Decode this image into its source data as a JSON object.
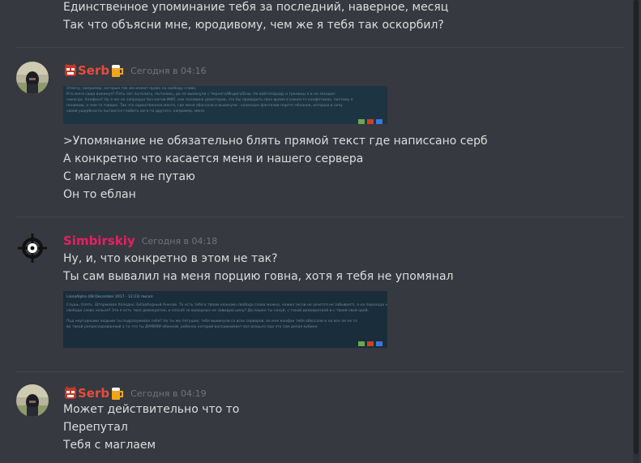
{
  "colors": {
    "background": "#36393f",
    "text": "#dcddde",
    "timestamp": "#72767d",
    "serb_name": "#e74c3c",
    "simbirskiy_name": "#e91e63"
  },
  "top_lines": [
    "Единственное упоминание тебя за последний, наверное, месяц",
    "Так что объясни мне, юродивому, чем же я тебя так оскорбил?"
  ],
  "messages": [
    {
      "author": "Serb",
      "timestamp": "Сегодня в 04:16",
      "icons": [
        "oni-mask-icon",
        "beer-mug-icon"
      ],
      "embed_lines": [
        "Отвечу, например, которые так же имеют право на свободу слова.",
        "Кто меня сюда выкинул? Пять лет пытались, пытались, да не выкинули с Черного/Индиго/Блю. Не вайтопараду и границы я и не заходил",
        "никогда. Апофеоз? Ну я же не запрещал без матов ИФП, как половина дематеров, что бы проводить свое время в каком-то конфетиках, поэтому я",
        "понимаю, а чем-то говорю. Так что единственное место, где меня обоссали и выкинули - казанные фантазии портят ебланов, которые в силу",
        "своей ущербности пытаются гнобить кого-то другого, например, меня."
      ],
      "lines": [
        ">Упомянание не обязательно блять прямой текст где написсано серб",
        "А конкретно что касается меня и нашего сервера",
        "С маглаем я не путаю",
        "Он то еблан"
      ]
    },
    {
      "author": "Simbirskiy",
      "timestamp": "Сегодня в 04:18",
      "icons": [
        "crosshair-icon"
      ],
      "embed_header": "LionaAlpha (08 December 2017 - 12:23) писал:",
      "embed_lines": [
        "Слушь, блять. Штормовая Холодно ЗаСвободный Анклав. То есть тебя в твоем кланомо свобода слова можно, нажил (если не хочется не забывает), а на перехода не тебе нашим",
        "свобода слова нельзя? Это я есть твоя демократия, и способ за выводных не завидую цену? Да пошел ты нахуй, с такой демократией и с твоей свой орой.",
        "Под неугодными людьми ты подразумевал себя? Но ты же пятушок, тебя выкинули со всех серверов, во мне конфак тебя обоссали и на все ли не то",
        "во такой репрессированный а то что ты ДУМВЯИ обанной, ребенок которой воспринимает все всерьез при это сам делая кубине."
      ],
      "lines": [
        "Ну, и, что конкретно в этом не так?",
        "Ты сам вывалил на меня порцию говна, хотя я тебя не упомянал"
      ]
    },
    {
      "author": "Serb",
      "timestamp": "Сегодня в 04:19",
      "icons": [
        "oni-mask-icon",
        "beer-mug-icon"
      ],
      "lines": [
        "Может действительно что то",
        "Перепутал",
        "Тебя с маглаем"
      ]
    }
  ]
}
